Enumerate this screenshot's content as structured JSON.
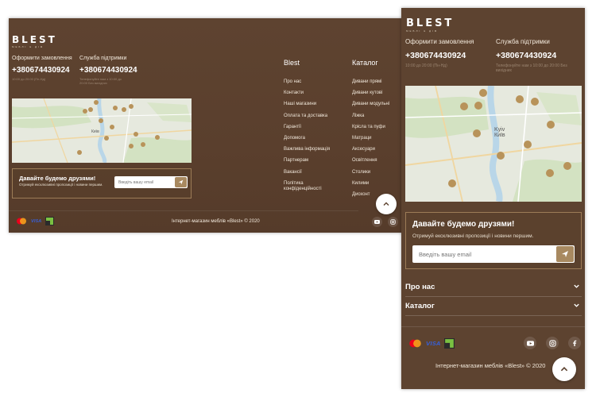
{
  "brand": {
    "logo": "BLEST",
    "tagline": "МЕБЛІ & ДІМ"
  },
  "contacts": {
    "order_label": "Оформити замовлення",
    "order_phone": "+380674430924",
    "order_hours": "10:00 до 20:00 (Пн-Нд)",
    "support_label": "Служба підтримки",
    "support_phone": "+380674430924",
    "support_hours": "Телефонуйте нам з 10:00 до 20:00 Без вихідних"
  },
  "map": {
    "city_label": "Київ",
    "city_label_en": "Kyiv"
  },
  "newsletter": {
    "title": "Давайте будемо друзями!",
    "text": "Отримуй ексклюзивні пропозиції і новини першим.",
    "placeholder": "Введіть вашу email"
  },
  "columns": {
    "blest": {
      "title": "Blest",
      "items": [
        "Про нас",
        "Контакти",
        "Наші магазини",
        "Оплата та доставка",
        "Гарантії",
        "Допомога",
        "Важлива інформація",
        "Партнерам",
        "Вакансії",
        "Політика конфіденційності"
      ]
    },
    "catalog": {
      "title": "Каталог",
      "items": [
        "Дивани прямі",
        "Дивани кутові",
        "Дивани модульні",
        "Ліжка",
        "Крісла та пуфи",
        "Матраци",
        "Аксесуари",
        "Освітлення",
        "Столики",
        "Килими",
        "Дисконт"
      ]
    }
  },
  "accordion": [
    {
      "label": "Про нас"
    },
    {
      "label": "Каталог"
    }
  ],
  "payments": {
    "visa": "VISA",
    "icons": [
      "mastercard-icon",
      "visa-icon",
      "privat-icon"
    ]
  },
  "social": [
    "youtube-icon",
    "instagram-icon",
    "facebook-icon"
  ],
  "copyright": "Інтернет-магазин меблів «Blest» © 2020",
  "colors": {
    "background": "#5d4330",
    "accent": "#a88960",
    "pin": "#b8935a"
  }
}
